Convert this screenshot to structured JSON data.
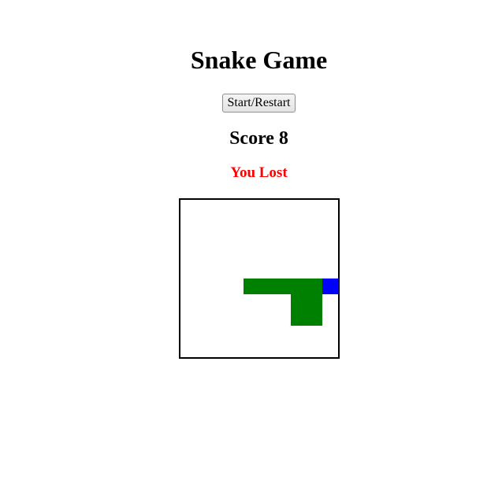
{
  "header": {
    "title": "Snake Game"
  },
  "controls": {
    "start_restart_label": "Start/Restart"
  },
  "score": {
    "label": "Score",
    "value": 8,
    "display": "Score 8"
  },
  "status": {
    "message": "You Lost",
    "color": "#ff0000"
  },
  "board": {
    "grid_columns": 10,
    "grid_rows": 10,
    "border_color": "#000000",
    "background_color": "#ffffff",
    "snake_color": "#008000",
    "head_color": "#0000ff",
    "snake": {
      "head": [
        9,
        5
      ],
      "body": [
        [
          8,
          5
        ],
        [
          7,
          5
        ],
        [
          6,
          5
        ],
        [
          5,
          5
        ],
        [
          4,
          5
        ],
        [
          7,
          6
        ],
        [
          8,
          6
        ],
        [
          7,
          7
        ],
        [
          8,
          7
        ]
      ]
    }
  }
}
